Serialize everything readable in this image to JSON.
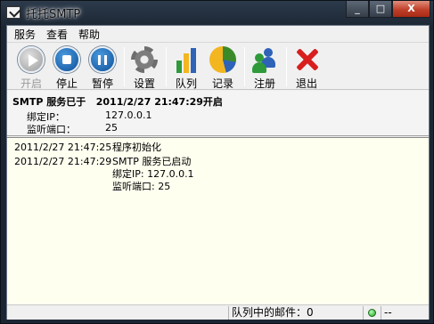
{
  "window": {
    "title": "托托SMTP",
    "minimize": "_",
    "maximize": "□",
    "close": "X"
  },
  "menu": {
    "items": [
      "服务",
      "查看",
      "帮助"
    ]
  },
  "toolbar": {
    "start": "开启",
    "stop": "停止",
    "pause": "暂停",
    "settings": "设置",
    "queue": "队列",
    "records": "记录",
    "register": "注册",
    "exit": "退出"
  },
  "info": {
    "status": "SMTP 服务已于   2011/2/27 21:47:29开启",
    "bind_label": "绑定IP：",
    "bind_value": "127.0.0.1",
    "port_label": "监听端口：",
    "port_value": "25"
  },
  "log": {
    "entries": [
      {
        "time": "2011/2/27 21:47:25",
        "message": "程序初始化"
      },
      {
        "time": "2011/2/27 21:47:29",
        "message": "SMTP 服务已启动\n绑定IP: 127.0.0.1\n监听端口: 25"
      }
    ]
  },
  "statusbar": {
    "queue": "队列中的邮件：0",
    "extra": "--"
  },
  "colors": {
    "log_bg": "#fffff0",
    "led": "#1fa11f",
    "exit_red": "#d81e1e",
    "button_blue": "#0d4f97"
  },
  "icons": {
    "start": "play-icon",
    "stop": "stop-icon",
    "pause": "pause-icon",
    "settings": "gear-icon",
    "queue": "bar-chart-icon",
    "records": "pie-chart-icon",
    "register": "users-icon",
    "exit": "x-icon"
  }
}
